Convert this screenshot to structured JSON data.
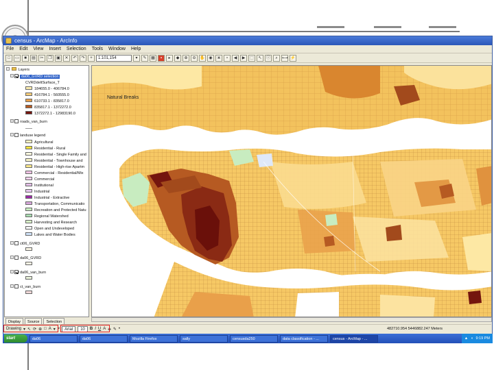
{
  "app": {
    "title": "census - ArcMap - ArcInfo"
  },
  "menu": [
    "File",
    "Edit",
    "View",
    "Insert",
    "Selection",
    "Tools",
    "Window",
    "Help"
  ],
  "toolbar": {
    "scale_value": "1:101,154"
  },
  "toc": {
    "root": "Layers",
    "selected_layer": "da06_GVRD selection",
    "field": "CVRDdeltSurface_T",
    "classes": [
      {
        "label": "184655.0 - 406784.0",
        "color": "#fbecb0"
      },
      {
        "label": "416784.1 - 560555.0",
        "color": "#f6cd7a"
      },
      {
        "label": "610733.1 - 835817.0",
        "color": "#e9a04a"
      },
      {
        "label": "835817.1 - 1372272.0",
        "color": "#b65a22"
      },
      {
        "label": "1372272.1 - 12983190.0",
        "color": "#74150e"
      }
    ],
    "roads_layer": "roads_van_burn",
    "landuse_layer": "landuse legend",
    "landuse_classes": [
      {
        "label": "Agricultural",
        "color": "#fff7c4"
      },
      {
        "label": "Residential - Rural",
        "color": "#f2e23c"
      },
      {
        "label": "Residential - Single Family and",
        "color": "#fffbe0"
      },
      {
        "label": "Residential - Townhouse and",
        "color": "#f8f4c8"
      },
      {
        "label": "Residential - High-rise Apartm",
        "color": "#fde98c"
      },
      {
        "label": "Commercial - Residential/Mix",
        "color": "#f0c2e4"
      },
      {
        "label": "Commercial",
        "color": "#f4d0ec"
      },
      {
        "label": "Institutional",
        "color": "#e4bfe8"
      },
      {
        "label": "Industrial",
        "color": "#e8c8f0"
      },
      {
        "label": "Industrial - Extractive",
        "color": "#9c2aa8"
      },
      {
        "label": "Transportation, Communicatio",
        "color": "#d8a8dc"
      },
      {
        "label": "Recreation and Protected Natu",
        "color": "#c8ecc0"
      },
      {
        "label": "Regional Watershed",
        "color": "#a8dcb0"
      },
      {
        "label": "Harvesting and Research",
        "color": "#d8f0c8"
      },
      {
        "label": "Open and Undeveloped",
        "color": "#f4f4f4"
      },
      {
        "label": "Lakes and Water Bodies",
        "color": "#cfe2f8"
      }
    ],
    "other_layers": [
      {
        "label": "ct06_GVRD",
        "checked": false,
        "color": "#f8f4e4"
      },
      {
        "label": "da06_GVRD",
        "checked": false,
        "color": "#f8f4e4"
      },
      {
        "label": "da06_van_burn",
        "checked": true,
        "color": "#e8f0d8"
      },
      {
        "label": "ct_van_burn",
        "checked": false,
        "color": "#f0d8d8"
      }
    ],
    "tabs": [
      "Display",
      "Source",
      "Selection"
    ]
  },
  "map": {
    "legend_label": "Natural Breaks"
  },
  "drawbar": {
    "label": "Drawing",
    "font_name": "Arial",
    "font_size": "10"
  },
  "status": {
    "coords": "482710.954  5446882.247 Meters"
  },
  "taskbar": {
    "start_label": "start",
    "items": [
      "da06",
      "da06",
      "Mozilla Firefox",
      "sally",
      "censusda250",
      "data classification - ...",
      "census - ArcMap - ..."
    ],
    "clock": "9:19 PM"
  }
}
